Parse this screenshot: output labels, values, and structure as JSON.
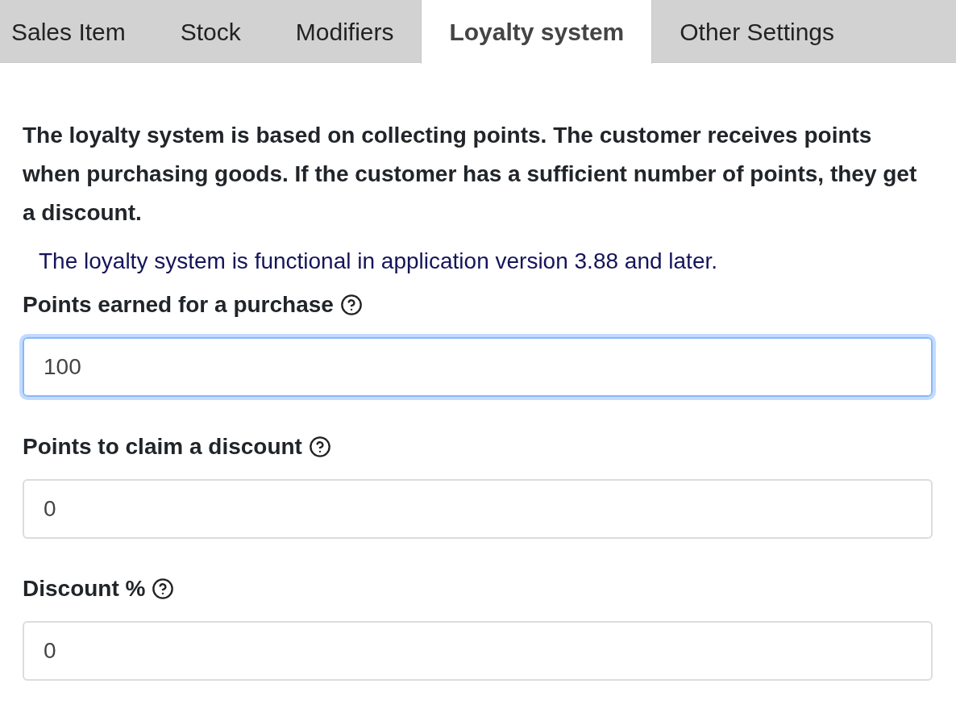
{
  "tabs": [
    {
      "label": "Sales Item",
      "selected": false
    },
    {
      "label": "Stock",
      "selected": false
    },
    {
      "label": "Modifiers",
      "selected": false
    },
    {
      "label": "Loyalty system",
      "selected": true
    },
    {
      "label": "Other Settings",
      "selected": false
    }
  ],
  "description": "The loyalty system is based on collecting points. The customer receives points when purchasing goods. If the customer has a sufficient number of points, they get a discount.",
  "note": "The loyalty system is functional in application version 3.88 and later.",
  "fields": [
    {
      "label": "Points earned for a purchase",
      "value": "100",
      "focused": true
    },
    {
      "label": "Points to claim a discount",
      "value": "0",
      "focused": false
    },
    {
      "label": "Discount %",
      "value": "0",
      "focused": false
    }
  ]
}
